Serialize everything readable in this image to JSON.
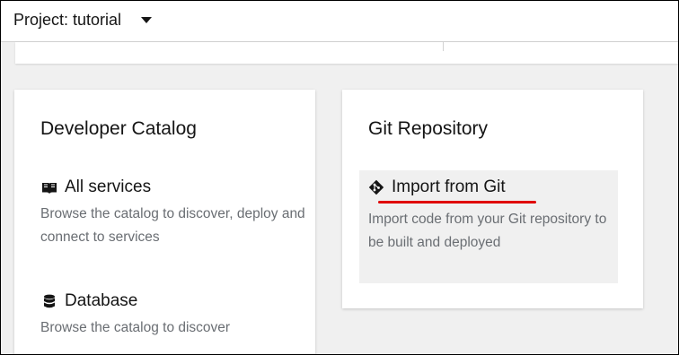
{
  "header": {
    "project_label": "Project: tutorial"
  },
  "developer_catalog": {
    "title": "Developer Catalog",
    "items": [
      {
        "label": "All services",
        "icon": "book-icon",
        "description": "Browse the catalog to discover, deploy and connect to services"
      },
      {
        "label": "Database",
        "icon": "database-icon",
        "description": "Browse the catalog to discover"
      }
    ]
  },
  "git_repository": {
    "title": "Git Repository",
    "items": [
      {
        "label": "Import from Git",
        "icon": "git-icon",
        "description": "Import code from your Git repository to be built and deployed"
      }
    ]
  },
  "colors": {
    "annotation_underline": "#e00000",
    "highlight_background": "#f0f0f0"
  }
}
